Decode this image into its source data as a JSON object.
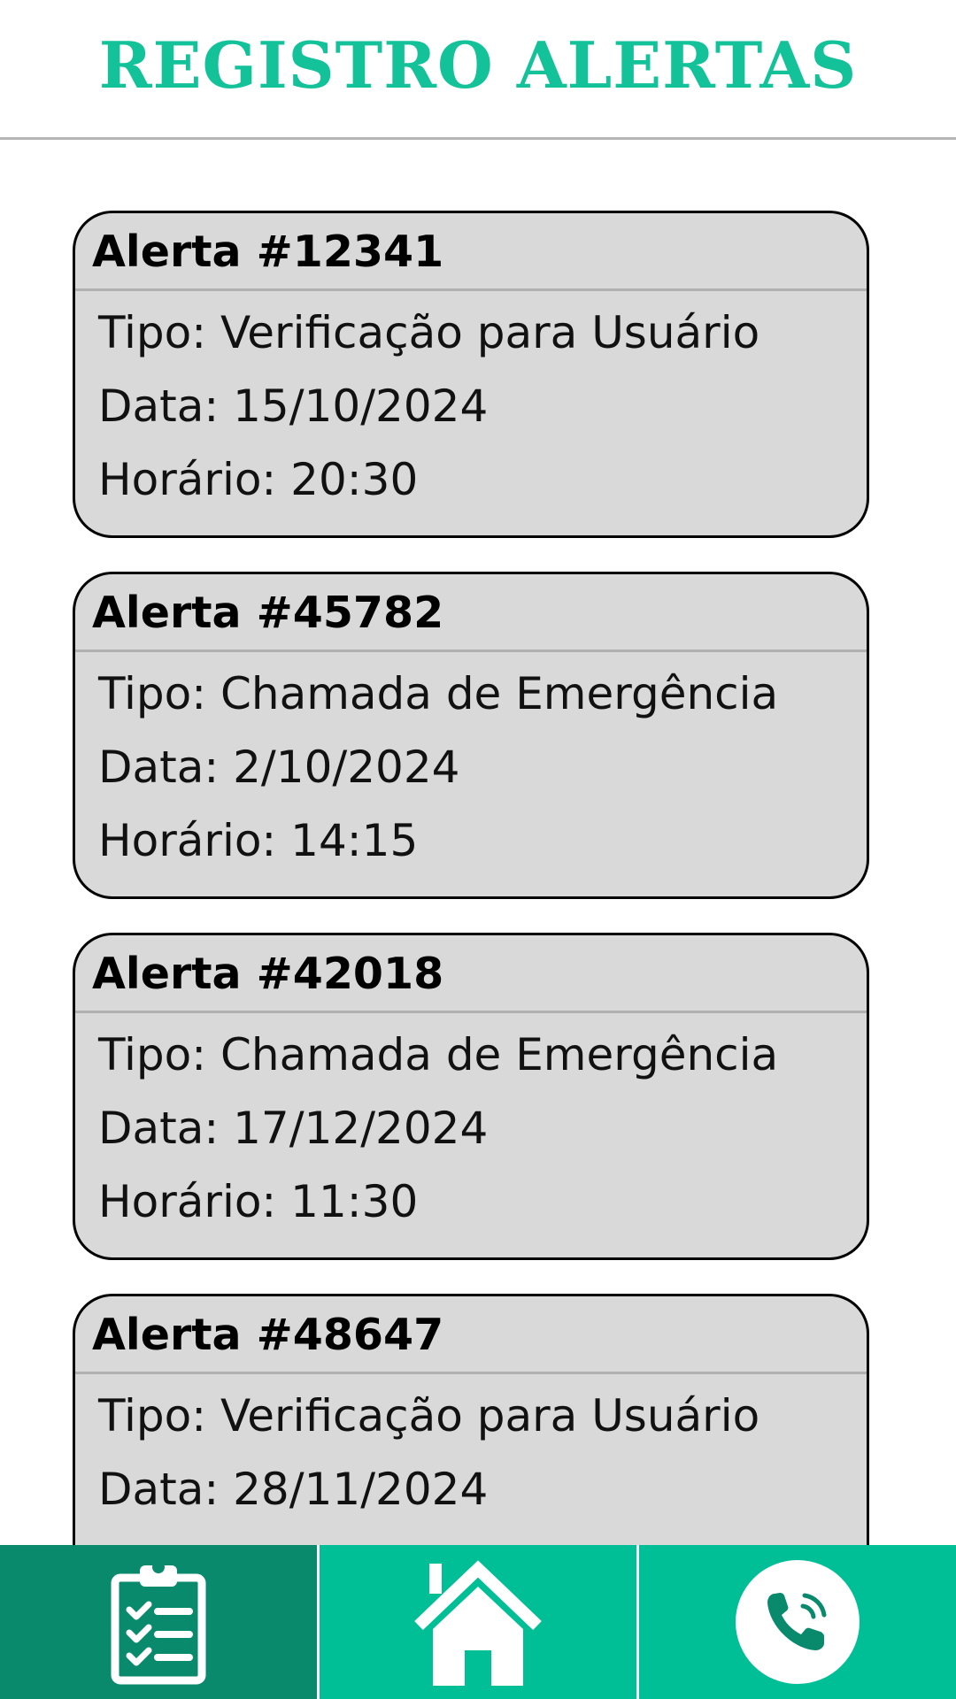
{
  "header": {
    "title": "REGISTRO ALERTAS"
  },
  "alerts": [
    {
      "title": "Alerta #12341",
      "tipo": "Tipo: Verificação para Usuário",
      "data": "Data: 15/10/2024",
      "horario": "Horário: 20:30"
    },
    {
      "title": "Alerta #45782",
      "tipo": "Tipo: Chamada de Emergência",
      "data": "Data: 2/10/2024",
      "horario": "Horário: 14:15"
    },
    {
      "title": "Alerta #42018",
      "tipo": "Tipo: Chamada de Emergência",
      "data": "Data: 17/12/2024",
      "horario": "Horário: 11:30"
    },
    {
      "title": "Alerta #48647",
      "tipo": "Tipo: Verificação para Usuário",
      "data": "Data: 28/11/2024",
      "horario": ""
    }
  ],
  "nav": {
    "items": [
      {
        "icon": "clipboard-checklist-icon",
        "active": true
      },
      {
        "icon": "home-icon",
        "active": false
      },
      {
        "icon": "phone-call-icon",
        "active": false
      }
    ]
  },
  "colors": {
    "accent": "#14c29a",
    "nav_bg": "#00bf97",
    "nav_active": "#098a6c",
    "card_bg": "#d9d9d9"
  }
}
